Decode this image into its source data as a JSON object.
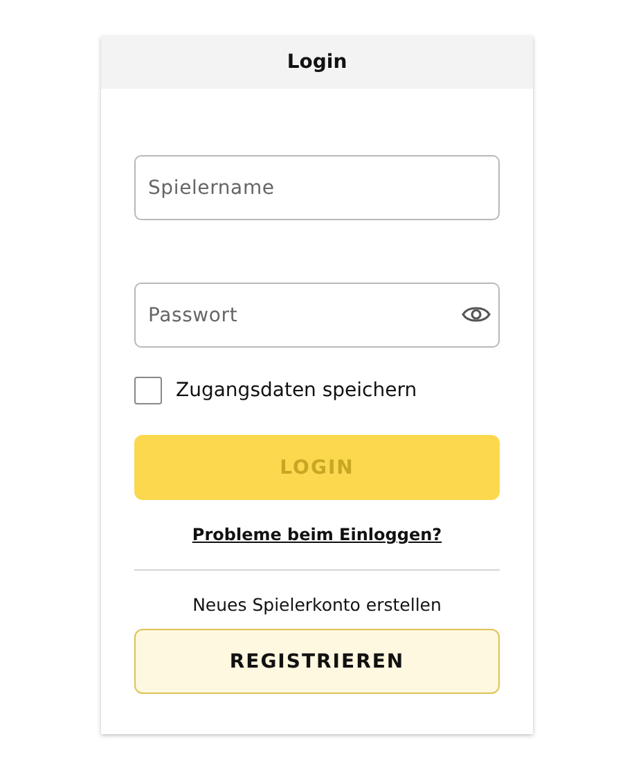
{
  "card": {
    "title": "Login"
  },
  "fields": [
    {
      "placeholder": "Spielername",
      "kind": "text"
    },
    {
      "placeholder": "Passwort",
      "kind": "password"
    }
  ],
  "remember": {
    "label": "Zugangsdaten speichern",
    "checked": false
  },
  "login_button": {
    "label": "LOGIN",
    "disabled": true
  },
  "help_link": "Probleme beim Einloggen?",
  "register_prompt": "Neues Spielerkonto erstellen",
  "register_button": {
    "label": "REGISTRIEREN"
  }
}
